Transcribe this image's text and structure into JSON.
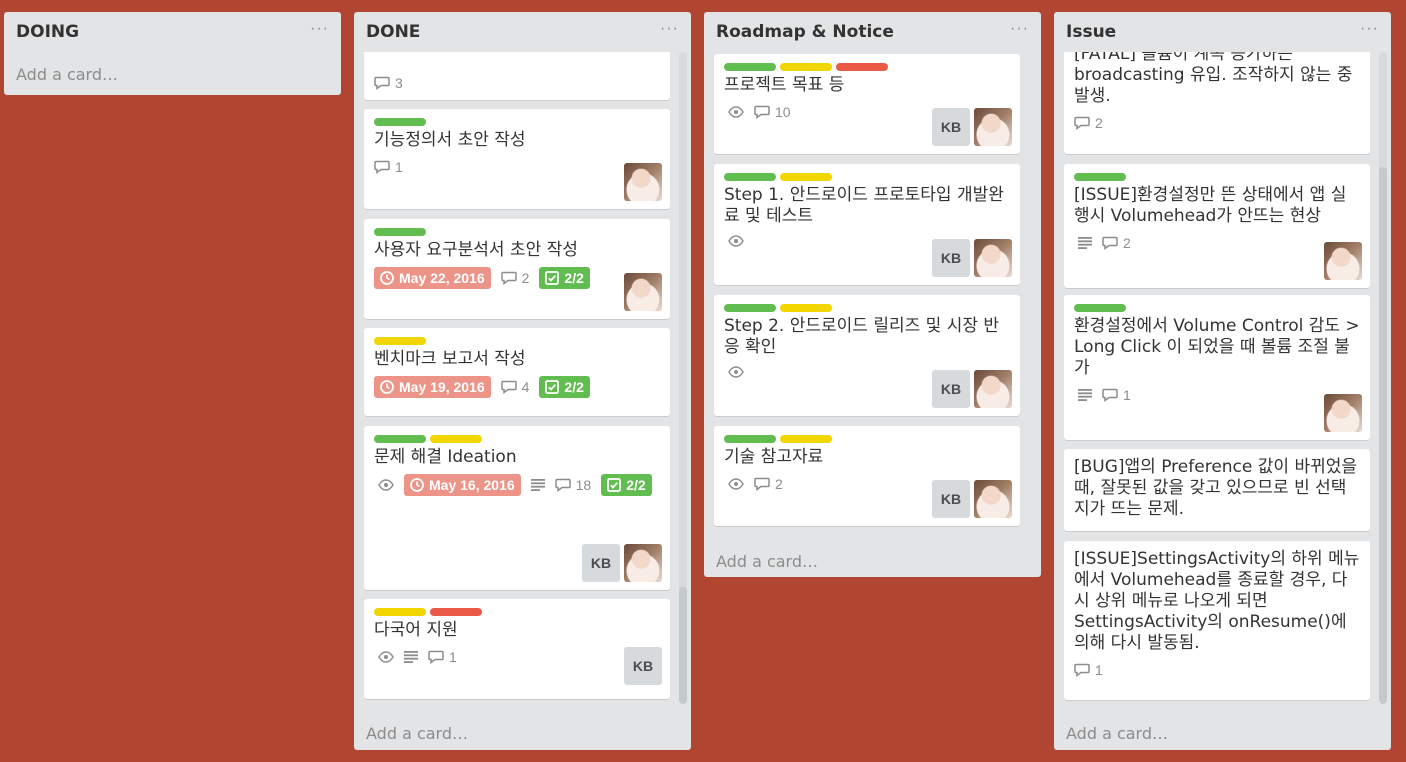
{
  "lists": {
    "doing": {
      "title": "DOING",
      "menu": "···",
      "add_card": "Add a card…"
    },
    "done": {
      "title": "DONE",
      "menu": "···",
      "add_card": "Add a card…",
      "cards": [
        {
          "title": "",
          "comments": "3"
        },
        {
          "title": "기능정의서 초안 작성",
          "comments": "1"
        },
        {
          "title": "사용자 요구분석서 초안 작성",
          "due": "May 22, 2016",
          "comments": "2",
          "checklist": "2/2"
        },
        {
          "title": "벤치마크 보고서 작성",
          "due": "May 19, 2016",
          "comments": "4",
          "checklist": "2/2"
        },
        {
          "title": "문제 해결 Ideation",
          "due": "May 16, 2016",
          "comments": "18",
          "checklist": "2/2",
          "member": "KB"
        },
        {
          "title": "다국어 지원",
          "comments": "1",
          "member": "KB"
        }
      ]
    },
    "roadmap": {
      "title": "Roadmap & Notice",
      "menu": "···",
      "add_card": "Add a card…",
      "cards": [
        {
          "title": "프로젝트 목표 등",
          "comments": "10",
          "member": "KB"
        },
        {
          "title": "Step 1. 안드로이드 프로토타입 개발완료 및 테스트",
          "member": "KB"
        },
        {
          "title": "Step 2. 안드로이드 릴리즈 및 시장 반응 확인",
          "member": "KB"
        },
        {
          "title": "기술 참고자료",
          "comments": "2",
          "member": "KB"
        }
      ]
    },
    "issue": {
      "title": "Issue",
      "menu": "···",
      "add_card": "Add a card…",
      "cards": [
        {
          "title": "[FATAL] 볼륨이 계속 증가하는 broadcasting 유입. 조작하지 않는 중 발생.",
          "comments": "2"
        },
        {
          "title": "[ISSUE]환경설정만 뜬 상태에서 앱 실행시 Volumehead가 안뜨는 현상",
          "comments": "2"
        },
        {
          "title": "환경설정에서 Volume Control 감도 > Long Click 이 되었을 때 볼륨 조절 불가",
          "comments": "1"
        },
        {
          "title": "[BUG]앱의 Preference 값이 바뀌었을 때, 잘못된 값을 갖고 있으므로 빈 선택지가 뜨는 문제."
        },
        {
          "title": "[ISSUE]SettingsActivity의 하위 메뉴에서 Volumehead를 종료할 경우, 다시 상위 메뉴로 나오게 되면 SettingsActivity의 onResume()에 의해 다시 발동됨.",
          "comments": "1"
        }
      ]
    }
  },
  "colors": {
    "board_bg": "#b04632",
    "label_green": "#61bd4f",
    "label_yellow": "#f2d600",
    "label_red": "#eb5a46",
    "due_bg": "#ec9488"
  },
  "icons": [
    "comment-icon",
    "eye-icon",
    "description-icon",
    "clock-icon",
    "checklist-icon"
  ]
}
